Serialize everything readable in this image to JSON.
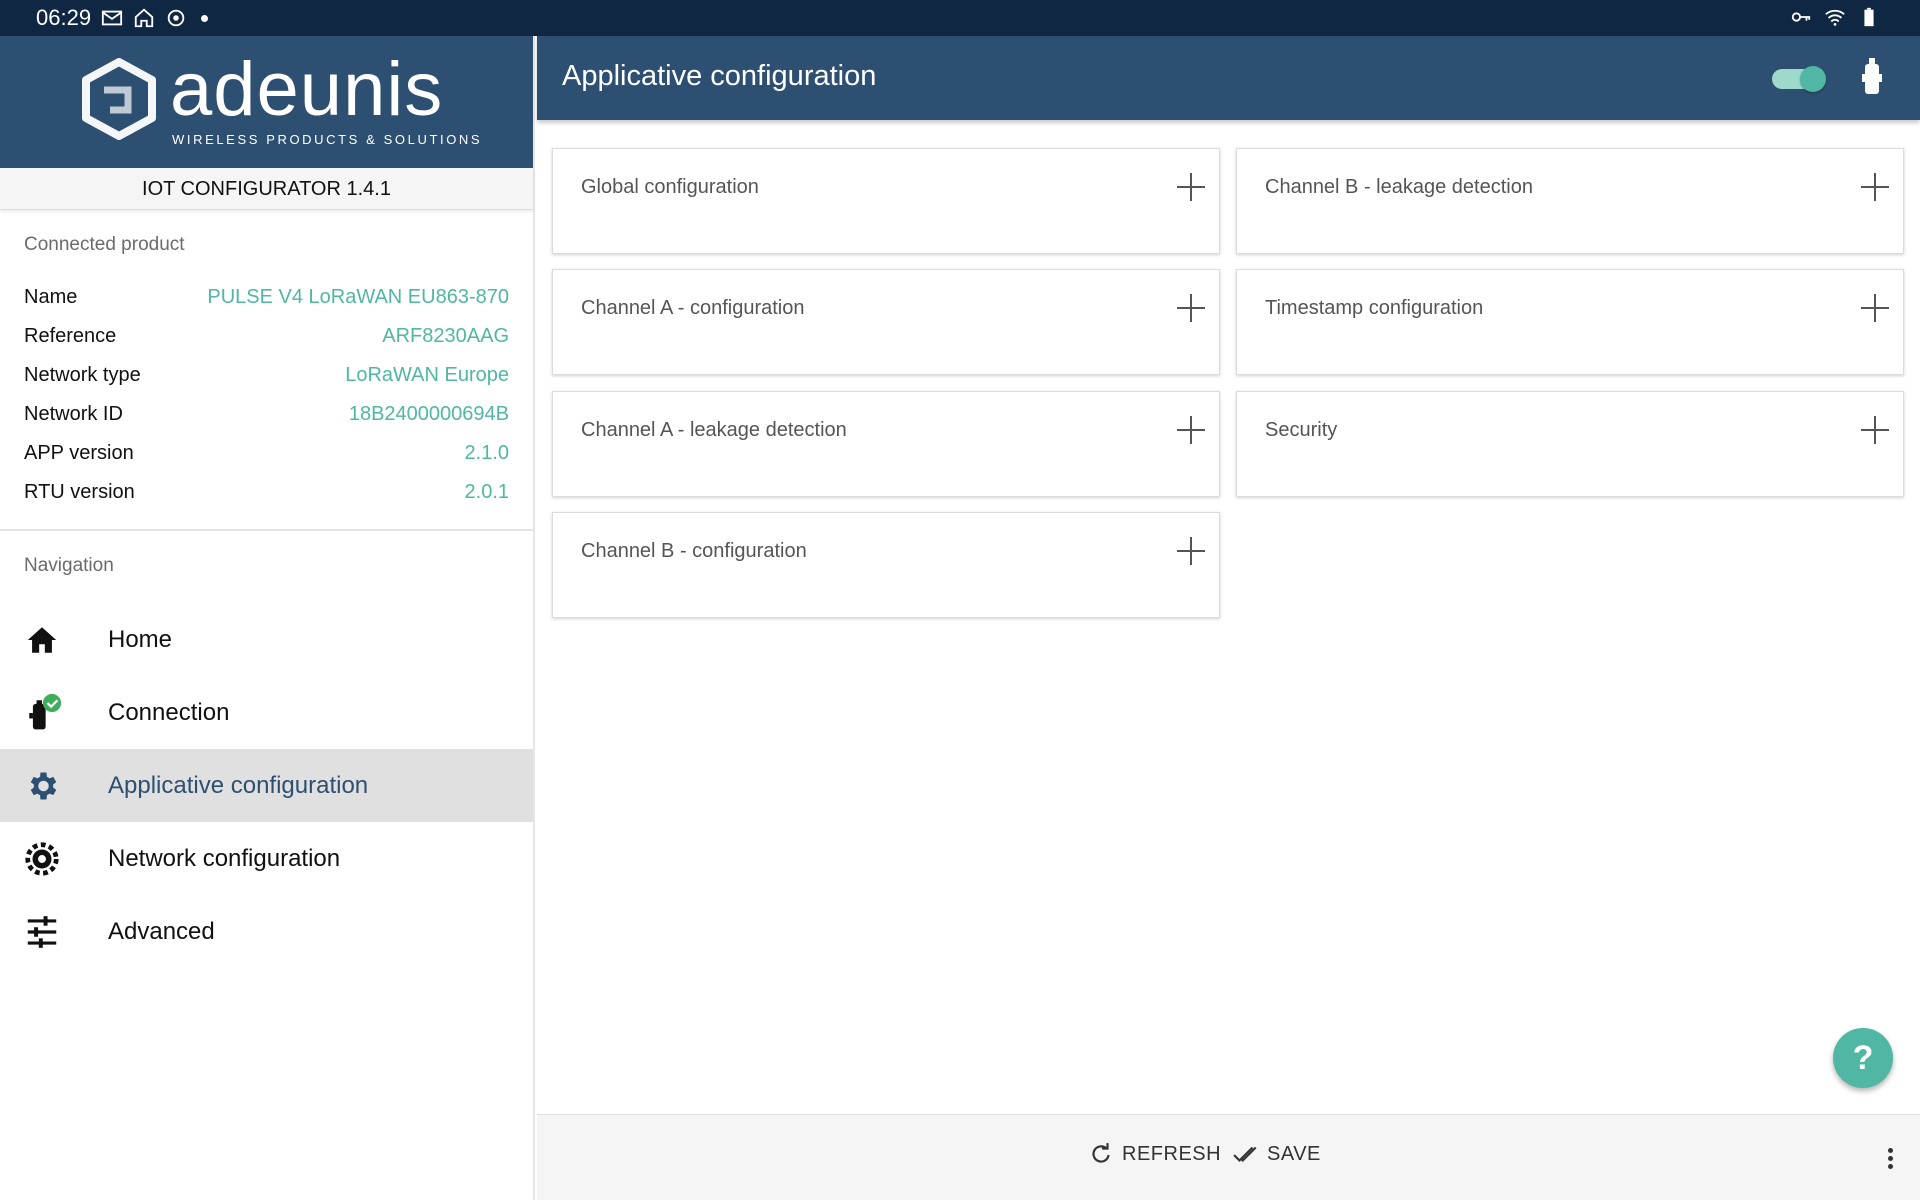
{
  "status_bar": {
    "time": "06:29"
  },
  "sidebar": {
    "brand": {
      "name": "adeunis",
      "tagline": "WIRELESS PRODUCTS & SOLUTIONS"
    },
    "version": "IOT CONFIGURATOR 1.4.1",
    "connected_product": {
      "title": "Connected product",
      "rows": [
        {
          "key": "Name",
          "value": "PULSE V4 LoRaWAN EU863-870"
        },
        {
          "key": "Reference",
          "value": "ARF8230AAG"
        },
        {
          "key": "Network type",
          "value": "LoRaWAN Europe"
        },
        {
          "key": "Network ID",
          "value": "18B2400000694B"
        },
        {
          "key": "APP version",
          "value": "2.1.0"
        },
        {
          "key": "RTU version",
          "value": "2.0.1"
        }
      ]
    },
    "navigation": {
      "title": "Navigation",
      "items": [
        {
          "label": "Home",
          "icon": "home-icon"
        },
        {
          "label": "Connection",
          "icon": "connection-device-icon"
        },
        {
          "label": "Applicative configuration",
          "icon": "gear-icon",
          "active": true
        },
        {
          "label": "Network configuration",
          "icon": "network-gear-icon"
        },
        {
          "label": "Advanced",
          "icon": "sliders-icon"
        }
      ]
    }
  },
  "main": {
    "title": "Applicative configuration",
    "toggle_on": true,
    "cards": [
      {
        "label": "Global configuration"
      },
      {
        "label": "Channel B - leakage detection"
      },
      {
        "label": "Channel A - configuration"
      },
      {
        "label": "Timestamp configuration"
      },
      {
        "label": "Channel A - leakage detection"
      },
      {
        "label": "Security"
      },
      {
        "label": "Channel B - configuration"
      }
    ],
    "fab_label": "?",
    "bottom_bar": {
      "refresh_label": "REFRESH",
      "save_label": "SAVE"
    }
  },
  "colors": {
    "primary": "#2d4f71",
    "accent": "#4fb7a3",
    "statusbar": "#0f2742"
  }
}
